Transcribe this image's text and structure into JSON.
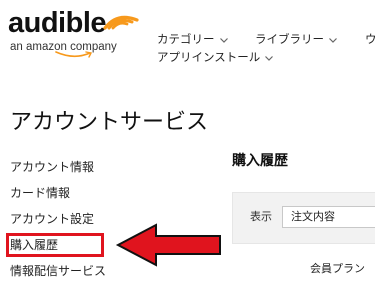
{
  "header": {
    "logo": {
      "wordmark": "audible",
      "tagline": "an amazon company",
      "brand_color": "#f7991c"
    },
    "nav": {
      "items": [
        {
          "label": "カテゴリー",
          "icon": "chevron-down-icon"
        },
        {
          "label": "ライブラリー",
          "icon": "chevron-down-icon"
        },
        {
          "label": "ウ"
        },
        {
          "label": "アプリインストール",
          "icon": "chevron-down-icon"
        }
      ]
    }
  },
  "page": {
    "title": "アカウントサービス"
  },
  "sidebar": {
    "items": [
      {
        "label": "アカウント情報"
      },
      {
        "label": "カード情報"
      },
      {
        "label": "アカウント設定"
      },
      {
        "label": "購入履歴",
        "highlighted": true
      },
      {
        "label": "情報配信サービス"
      }
    ],
    "highlight_color": "#e0141e"
  },
  "main": {
    "section_title": "購入履歴",
    "filter": {
      "label": "表示",
      "selected": "注文内容"
    },
    "table": {
      "headers": [
        "会員プラン"
      ]
    }
  },
  "annotation": {
    "arrow_color": "#e0141e",
    "arrow_direction": "left"
  }
}
